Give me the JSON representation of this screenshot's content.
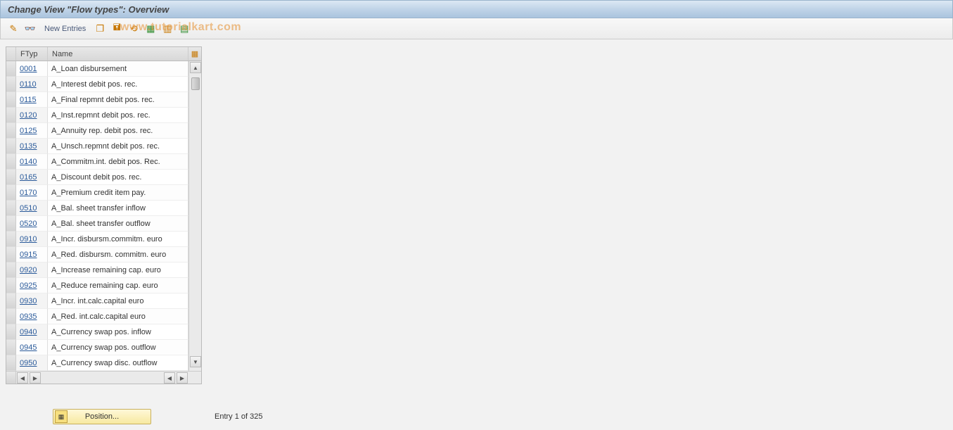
{
  "title": "Change View \"Flow types\": Overview",
  "toolbar": {
    "new_entries_label": "New Entries"
  },
  "watermark": "www.tutorialkart.com",
  "table": {
    "headers": {
      "ftyp": "FTyp",
      "name": "Name"
    },
    "rows": [
      {
        "ftyp": "0001",
        "name": "A_Loan disbursement",
        "selected": true
      },
      {
        "ftyp": "0110",
        "name": "A_Interest debit pos. rec."
      },
      {
        "ftyp": "0115",
        "name": "A_Final repmnt debit pos. rec."
      },
      {
        "ftyp": "0120",
        "name": "A_Inst.repmnt debit pos. rec."
      },
      {
        "ftyp": "0125",
        "name": "A_Annuity rep. debit pos. rec."
      },
      {
        "ftyp": "0135",
        "name": "A_Unsch.repmnt debit pos. rec."
      },
      {
        "ftyp": "0140",
        "name": "A_Commitm.int. debit pos. Rec."
      },
      {
        "ftyp": "0165",
        "name": "A_Discount debit pos. rec."
      },
      {
        "ftyp": "0170",
        "name": "A_Premium credit item pay."
      },
      {
        "ftyp": "0510",
        "name": "A_Bal. sheet transfer inflow"
      },
      {
        "ftyp": "0520",
        "name": "A_Bal. sheet transfer outflow"
      },
      {
        "ftyp": "0910",
        "name": "A_Incr. disbursm.commitm. euro"
      },
      {
        "ftyp": "0915",
        "name": "A_Red. disbursm. commitm. euro"
      },
      {
        "ftyp": "0920",
        "name": "A_Increase remaining cap. euro"
      },
      {
        "ftyp": "0925",
        "name": "A_Reduce remaining cap. euro"
      },
      {
        "ftyp": "0930",
        "name": "A_Incr. int.calc.capital euro"
      },
      {
        "ftyp": "0935",
        "name": "A_Red. int.calc.capital euro"
      },
      {
        "ftyp": "0940",
        "name": "A_Currency swap pos. inflow"
      },
      {
        "ftyp": "0945",
        "name": "A_Currency swap pos. outflow"
      },
      {
        "ftyp": "0950",
        "name": "A_Currency swap disc. outflow"
      }
    ]
  },
  "footer": {
    "position_label": "Position...",
    "entry_info": "Entry 1 of 325"
  }
}
